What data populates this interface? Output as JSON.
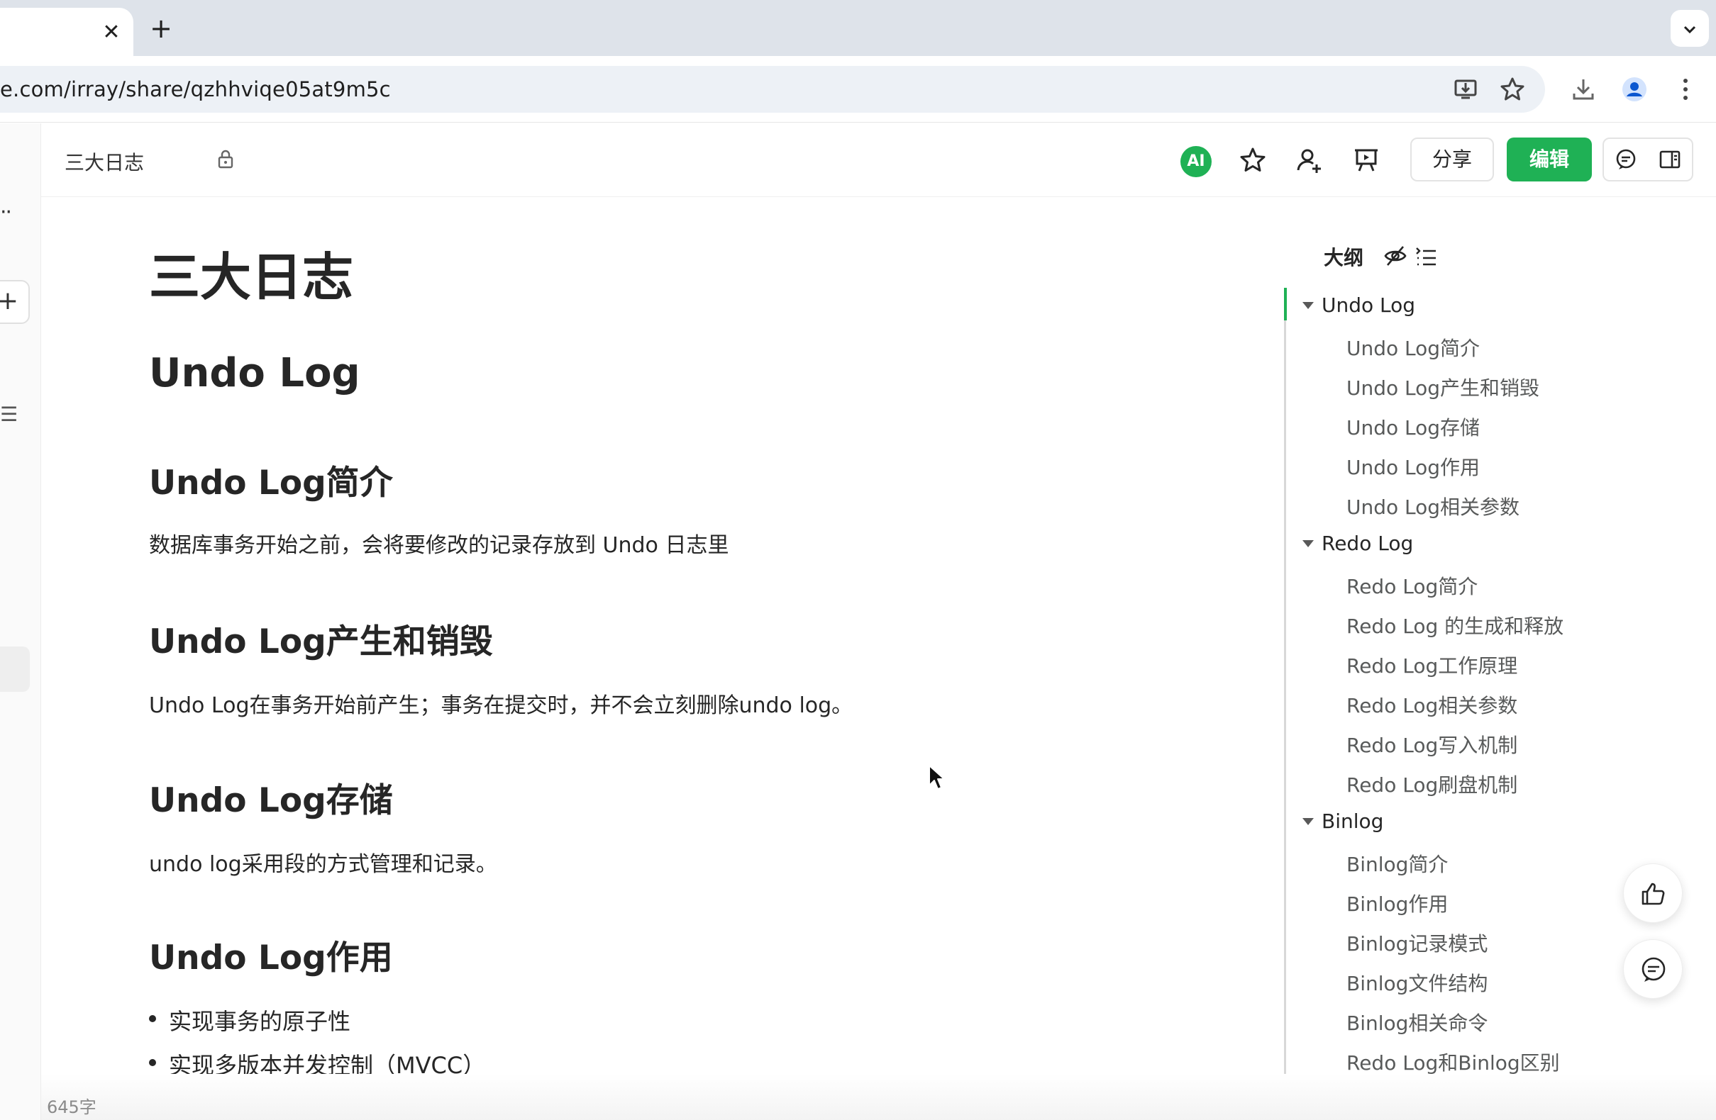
{
  "browser": {
    "url": "e.com/irray/share/qzhhviqe05at9m5c",
    "tab_close": "✕",
    "new_tab": "+"
  },
  "header": {
    "breadcrumb": "三大日志",
    "ai_label": "AI",
    "share_label": "分享",
    "edit_label": "编辑"
  },
  "document": {
    "title": "三大日志",
    "section_heading": "Undo Log",
    "sections": [
      {
        "heading": "Undo Log简介",
        "text": "数据库事务开始之前，会将要修改的记录存放到 Undo 日志里"
      },
      {
        "heading": "Undo Log产生和销毁",
        "text": "Undo Log在事务开始前产生；事务在提交时，并不会立刻删除undo log。"
      },
      {
        "heading": "Undo Log存储",
        "text": "undo log采用段的方式管理和记录。"
      },
      {
        "heading": "Undo Log作用",
        "bullets": [
          "实现事务的原子性",
          "实现多版本并发控制（MVCC）"
        ]
      }
    ]
  },
  "outline": {
    "title": "大纲",
    "groups": [
      {
        "label": "Undo Log",
        "items": [
          "Undo Log简介",
          "Undo Log产生和销毁",
          "Undo Log存储",
          "Undo Log作用",
          "Undo Log相关参数"
        ]
      },
      {
        "label": "Redo Log",
        "items": [
          "Redo Log简介",
          "Redo Log 的生成和释放",
          "Redo Log工作原理",
          "Redo Log相关参数",
          "Redo Log写入机制",
          "Redo Log刷盘机制"
        ]
      },
      {
        "label": "Binlog",
        "items": [
          "Binlog简介",
          "Binlog作用",
          "Binlog记录模式",
          "Binlog文件结构",
          "Binlog相关命令",
          "Redo Log和Binlog区别"
        ]
      }
    ]
  },
  "footer": {
    "word_count": "645字"
  },
  "colors": {
    "accent": "#1fb155",
    "tabstrip": "#dee3ea",
    "omnibox": "#edf1f6"
  }
}
